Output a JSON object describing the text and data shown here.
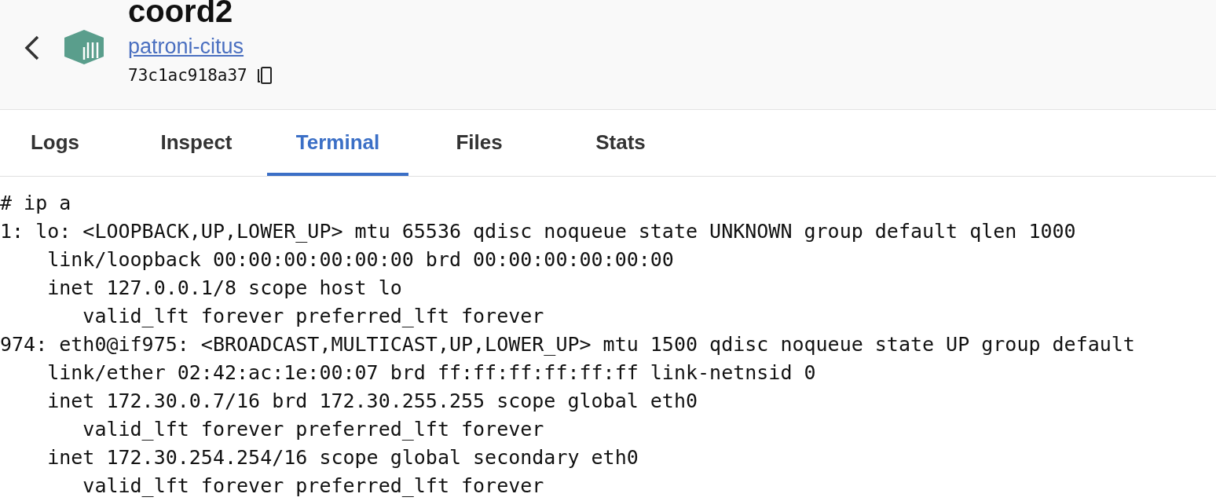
{
  "header": {
    "title": "coord2",
    "image_link": "patroni-citus",
    "container_id": "73c1ac918a37"
  },
  "tabs": [
    {
      "label": "Logs",
      "selected": false
    },
    {
      "label": "Inspect",
      "selected": false
    },
    {
      "label": "Terminal",
      "selected": true
    },
    {
      "label": "Files",
      "selected": false
    },
    {
      "label": "Stats",
      "selected": false
    }
  ],
  "terminal": {
    "lines": [
      "# ip a",
      "1: lo: <LOOPBACK,UP,LOWER_UP> mtu 65536 qdisc noqueue state UNKNOWN group default qlen 1000",
      "    link/loopback 00:00:00:00:00:00 brd 00:00:00:00:00:00",
      "    inet 127.0.0.1/8 scope host lo",
      "       valid_lft forever preferred_lft forever",
      "974: eth0@if975: <BROADCAST,MULTICAST,UP,LOWER_UP> mtu 1500 qdisc noqueue state UP group default",
      "    link/ether 02:42:ac:1e:00:07 brd ff:ff:ff:ff:ff:ff link-netnsid 0",
      "    inet 172.30.0.7/16 brd 172.30.255.255 scope global eth0",
      "       valid_lft forever preferred_lft forever",
      "    inet 172.30.254.254/16 scope global secondary eth0",
      "       valid_lft forever preferred_lft forever"
    ]
  }
}
